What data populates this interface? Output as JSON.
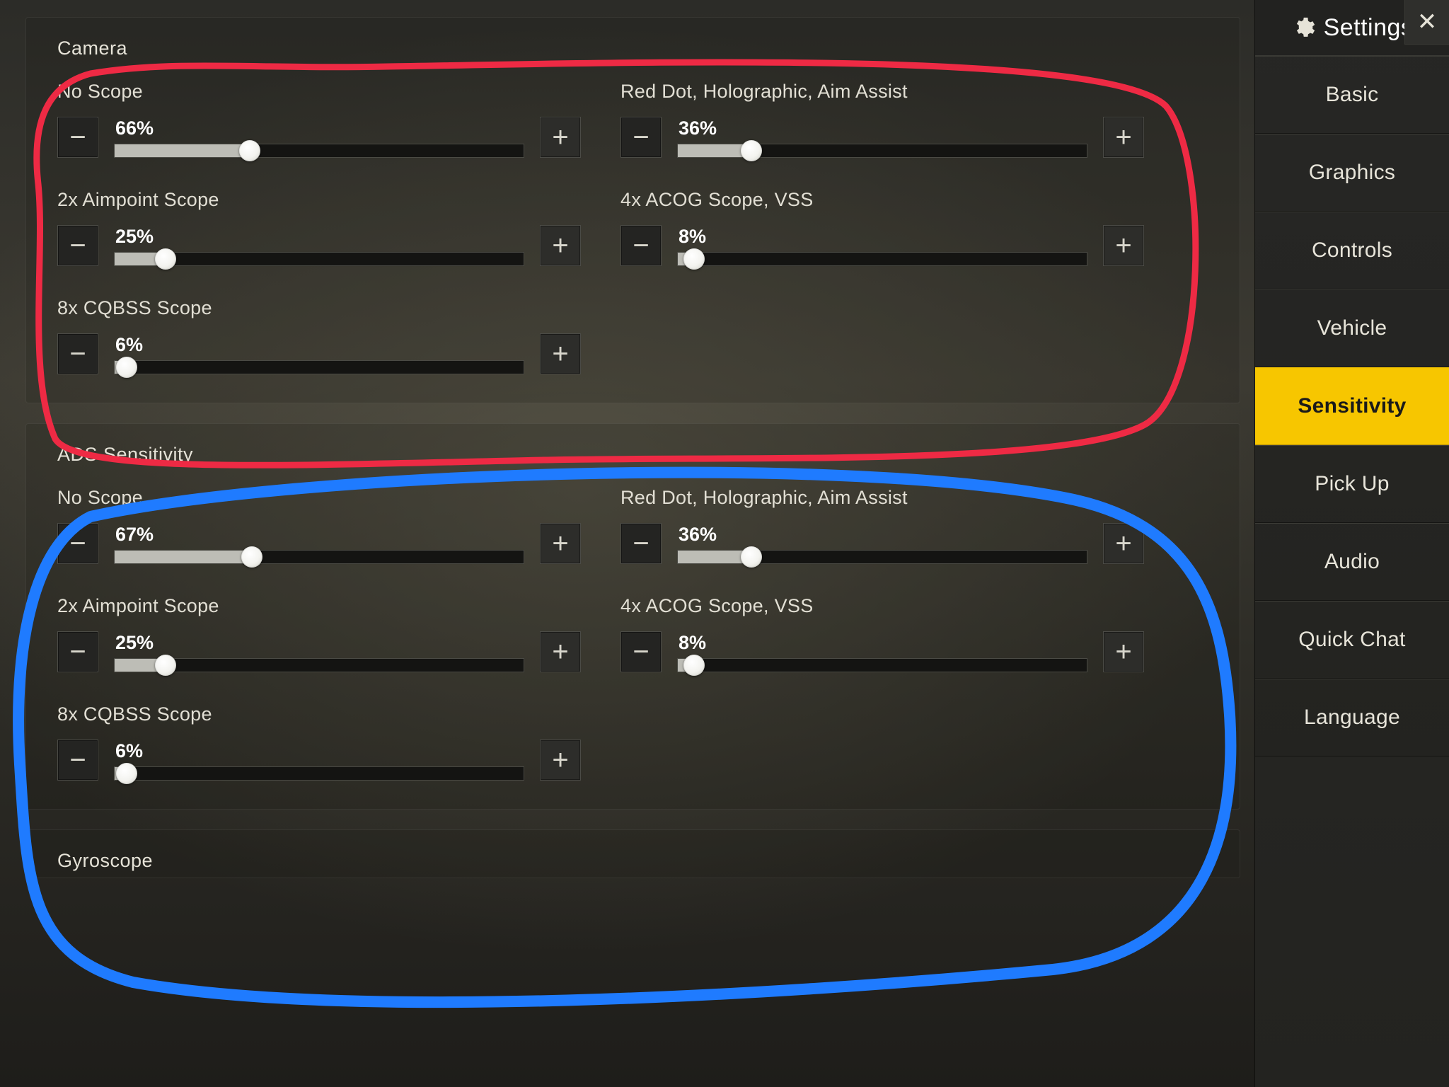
{
  "sidebar": {
    "title": "Settings",
    "tabs": [
      {
        "label": "Basic"
      },
      {
        "label": "Graphics"
      },
      {
        "label": "Controls"
      },
      {
        "label": "Vehicle"
      },
      {
        "label": "Sensitivity"
      },
      {
        "label": "Pick Up"
      },
      {
        "label": "Audio"
      },
      {
        "label": "Quick Chat"
      },
      {
        "label": "Language"
      }
    ],
    "active_index": 4
  },
  "sections": {
    "camera": {
      "title": "Camera",
      "sliders": [
        {
          "label": "No Scope",
          "value": 66,
          "display": "66%"
        },
        {
          "label": "Red Dot, Holographic, Aim Assist",
          "value": 36,
          "display": "36%"
        },
        {
          "label": "2x Aimpoint Scope",
          "value": 25,
          "display": "25%"
        },
        {
          "label": "4x ACOG Scope, VSS",
          "value": 8,
          "display": "8%"
        },
        {
          "label": "8x CQBSS Scope",
          "value": 6,
          "display": "6%"
        }
      ]
    },
    "ads": {
      "title": "ADS Sensitivity",
      "sliders": [
        {
          "label": "No Scope",
          "value": 67,
          "display": "67%"
        },
        {
          "label": "Red Dot, Holographic, Aim Assist",
          "value": 36,
          "display": "36%"
        },
        {
          "label": "2x Aimpoint Scope",
          "value": 25,
          "display": "25%"
        },
        {
          "label": "4x ACOG Scope, VSS",
          "value": 8,
          "display": "8%"
        },
        {
          "label": "8x CQBSS Scope",
          "value": 6,
          "display": "6%"
        }
      ]
    },
    "gyroscope": {
      "title": "Gyroscope"
    }
  },
  "annotation_colors": {
    "camera": "#ee2a44",
    "ads": "#1f7bff"
  }
}
